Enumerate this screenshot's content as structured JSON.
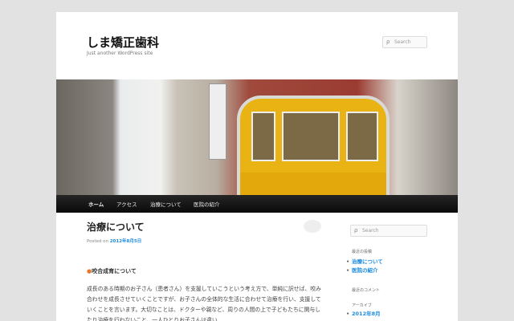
{
  "site": {
    "title": "しま矯正歯科",
    "description": "Just another WordPress site"
  },
  "header_search": {
    "placeholder": "Search"
  },
  "nav": [
    "ホーム",
    "アクセス",
    "治療について",
    "医院の紹介"
  ],
  "post": {
    "title": "治療について",
    "posted_on": "Posted on",
    "date": "2012年8月5日",
    "subheading_marker": "●",
    "subheading": "咬合成育について",
    "body": "成長のある時期のお子さん（患者さん）を支援していこうという考え方で、単純に訳せば、咬み合わせを成長させていくことですが、お子さんの全体的な生活に合わせて治療を行い、支援していくことを言います。大切なことは、ドクターや親など、周りの人間の上で子どもたちに関与したり治療を行わないこと、一人ひとりお子さんは違い"
  },
  "sidebar": {
    "search_placeholder": "Search",
    "recent_posts_title": "最近の投稿",
    "recent_posts": [
      "治療について",
      "医院の紹介"
    ],
    "recent_comments_title": "最近のコメント",
    "archives_title": "アーカイブ",
    "archives": [
      "2012年8月"
    ]
  }
}
